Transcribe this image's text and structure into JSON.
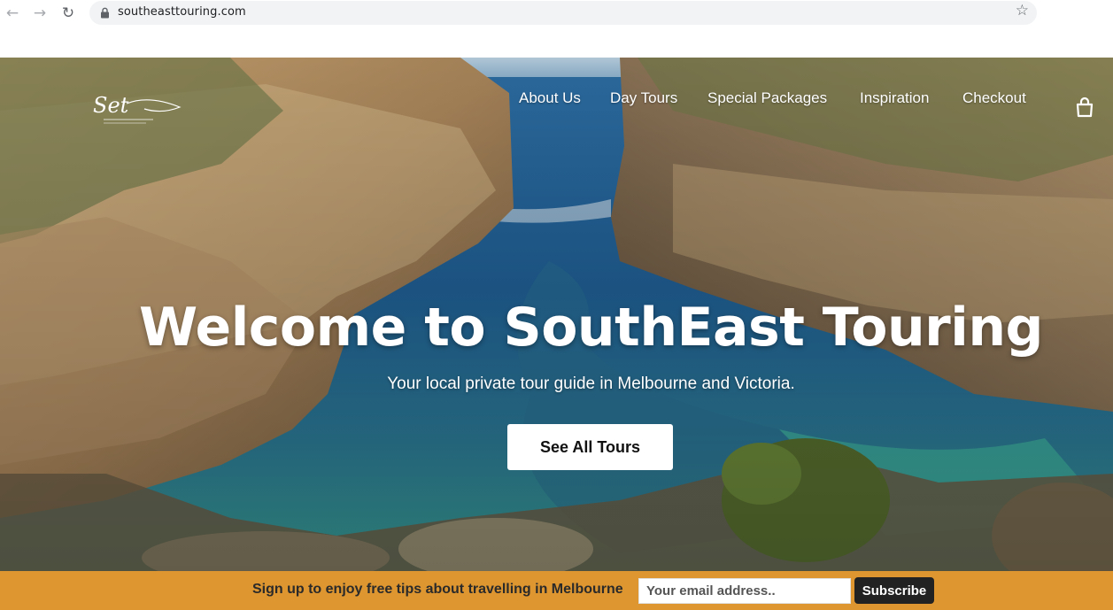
{
  "browser": {
    "url": "southeasttouring.com",
    "back_icon": "←",
    "forward_icon": "→",
    "reload_icon": "↻",
    "star_icon": "☆"
  },
  "site": {
    "logo_text": "Set",
    "nav": {
      "about": "About Us",
      "day_tours": "Day Tours",
      "special": "Special Packages",
      "inspiration": "Inspiration",
      "checkout": "Checkout"
    },
    "cart_icon": "shopping-bag-icon"
  },
  "hero": {
    "title": "Welcome to SouthEast Touring",
    "subtitle": "Your local private tour guide in Melbourne and Victoria.",
    "cta": "See All Tours"
  },
  "signup": {
    "text": "Sign up to enjoy free tips about travelling in Melbourne",
    "placeholder": "Your email address..",
    "button": "Subscribe"
  },
  "colors": {
    "signup_bar": "#de9630",
    "subscribe_button": "#222222",
    "omnibox": "#f1f3f4"
  }
}
